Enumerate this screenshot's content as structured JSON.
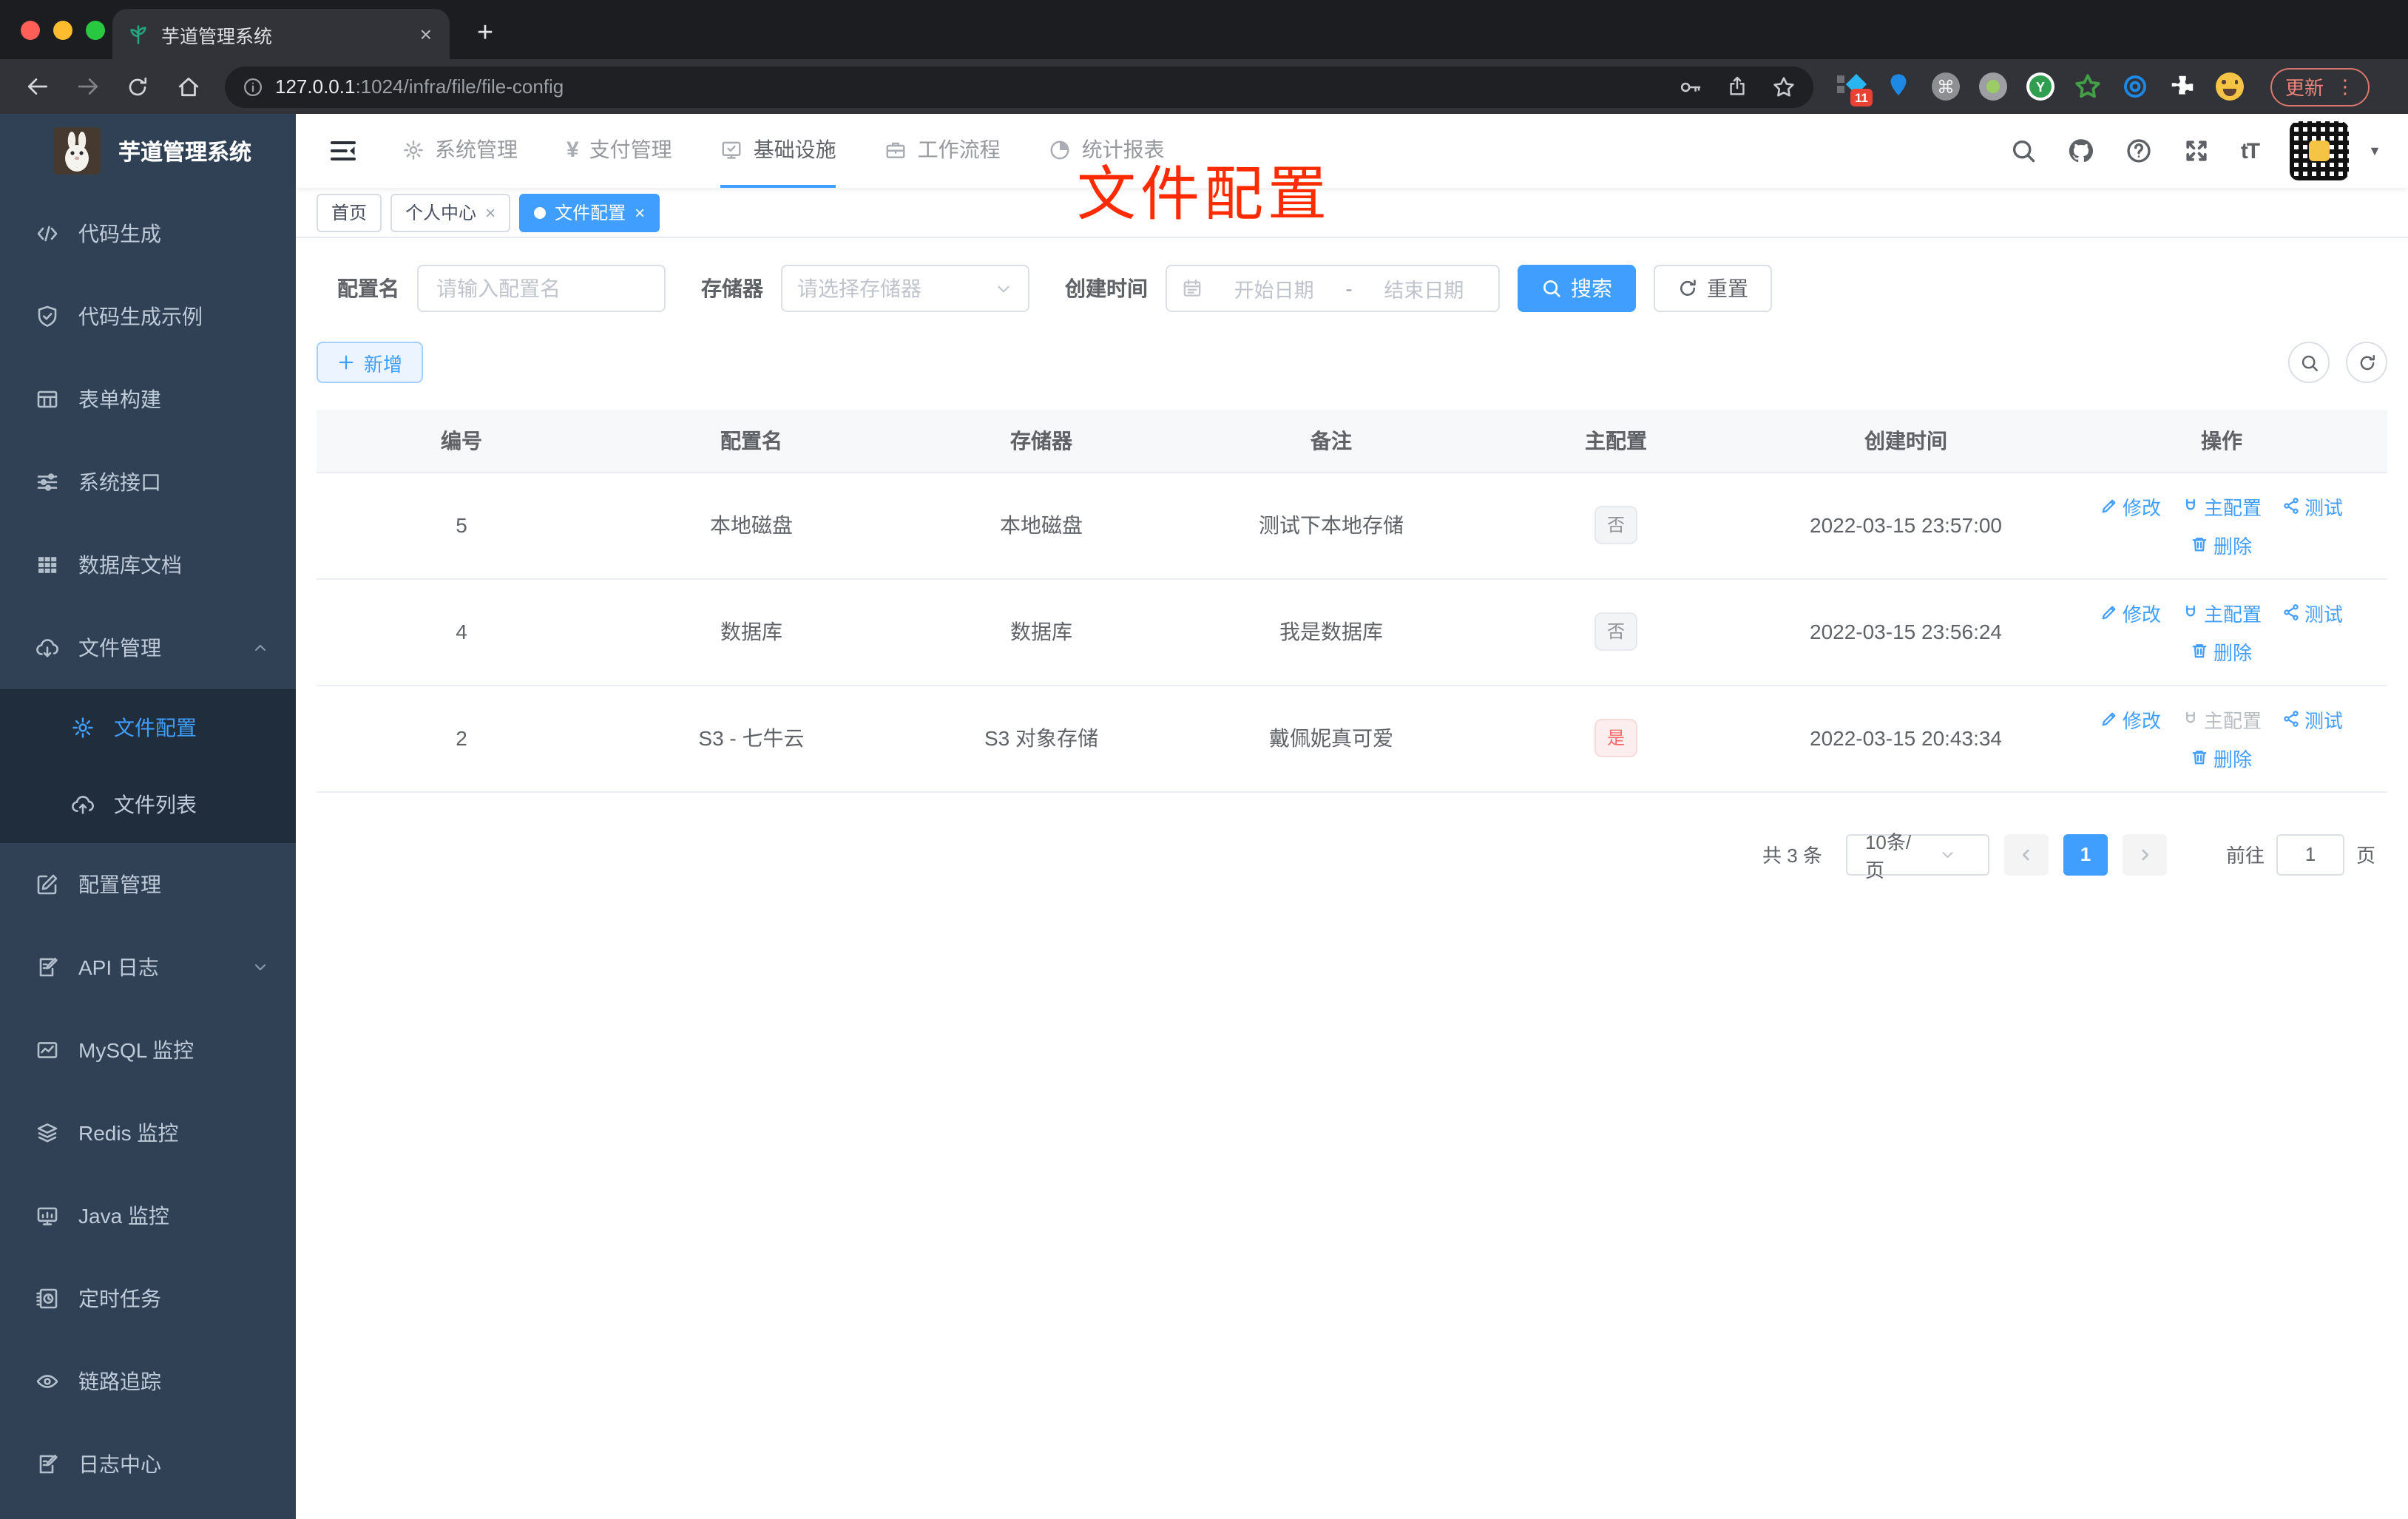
{
  "browser": {
    "tab_title": "芋道管理系统",
    "new_tab": "+",
    "close_tab": "×",
    "url_host": "127.0.0.1",
    "url_rest": ":1024/infra/file/file-config",
    "ext_badge": "11",
    "update_label": "更新"
  },
  "sidebar": {
    "logo_title": "芋道管理系统",
    "items": [
      {
        "label": "代码生成",
        "icon": "code-icon"
      },
      {
        "label": "代码生成示例",
        "icon": "shield-check-icon"
      },
      {
        "label": "表单构建",
        "icon": "table-icon"
      },
      {
        "label": "系统接口",
        "icon": "sliders-icon"
      },
      {
        "label": "数据库文档",
        "icon": "grid-icon"
      },
      {
        "label": "文件管理",
        "icon": "cloud-download-icon",
        "expanded": true
      },
      {
        "label": "文件配置",
        "icon": "gear-icon",
        "sub": true,
        "active": true
      },
      {
        "label": "文件列表",
        "icon": "cloud-upload-icon",
        "sub": true
      },
      {
        "label": "配置管理",
        "icon": "edit-square-icon"
      },
      {
        "label": "API 日志",
        "icon": "note-edit-icon",
        "collapsed": true
      },
      {
        "label": "MySQL 监控",
        "icon": "chart-icon"
      },
      {
        "label": "Redis 监控",
        "icon": "layers-icon"
      },
      {
        "label": "Java 监控",
        "icon": "monitor-icon"
      },
      {
        "label": "定时任务",
        "icon": "schedule-icon"
      },
      {
        "label": "链路追踪",
        "icon": "eye-icon"
      },
      {
        "label": "日志中心",
        "icon": "note-edit-icon"
      }
    ]
  },
  "navbar": {
    "menus": [
      {
        "label": "系统管理",
        "icon": "gear-icon"
      },
      {
        "label": "支付管理",
        "icon": "yen-icon"
      },
      {
        "label": "基础设施",
        "icon": "infra-monitor-icon",
        "active": true
      },
      {
        "label": "工作流程",
        "icon": "briefcase-icon"
      },
      {
        "label": "统计报表",
        "icon": "pie-chart-icon"
      }
    ],
    "font_size_label": "tT"
  },
  "tags": [
    {
      "label": "首页"
    },
    {
      "label": "个人中心",
      "closable": true
    },
    {
      "label": "文件配置",
      "closable": true,
      "active": true
    }
  ],
  "overlay": {
    "text": "文件配置"
  },
  "filter": {
    "name_label": "配置名",
    "name_placeholder": "请输入配置名",
    "storage_label": "存储器",
    "storage_placeholder": "请选择存储器",
    "time_label": "创建时间",
    "start_placeholder": "开始日期",
    "separator": "-",
    "end_placeholder": "结束日期",
    "search_label": "搜索",
    "reset_label": "重置"
  },
  "toolbar": {
    "add_label": "新增"
  },
  "table": {
    "headers": [
      "编号",
      "配置名",
      "存储器",
      "备注",
      "主配置",
      "创建时间",
      "操作"
    ],
    "actions": {
      "edit": "修改",
      "master": "主配置",
      "test": "测试",
      "delete": "删除"
    },
    "rows": [
      {
        "id": "5",
        "name": "本地磁盘",
        "storage": "本地磁盘",
        "remark": "测试下本地存储",
        "master": "否",
        "created": "2022-03-15 23:57:00"
      },
      {
        "id": "4",
        "name": "数据库",
        "storage": "数据库",
        "remark": "我是数据库",
        "master": "否",
        "created": "2022-03-15 23:56:24"
      },
      {
        "id": "2",
        "name": "S3 - 七牛云",
        "storage": "S3 对象存储",
        "remark": "戴佩妮真可爱",
        "master": "是",
        "created": "2022-03-15 20:43:34"
      }
    ]
  },
  "pagination": {
    "total": "共 3 条",
    "page_size": "10条/页",
    "current": "1",
    "goto_label": "前往",
    "goto_value": "1",
    "page_label": "页"
  },
  "colors": {
    "accent": "#409eff",
    "danger": "#f56c6c",
    "sidebar": "#304156",
    "annotation": "#ff2b00"
  }
}
